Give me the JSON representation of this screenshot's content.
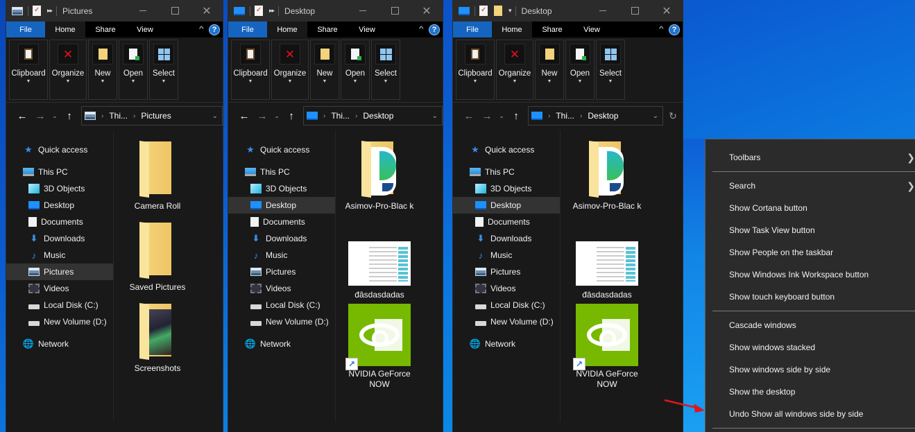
{
  "windows": [
    {
      "title": "Pictures",
      "location_icon": "pictures-icon",
      "ribbon_tabs": [
        "File",
        "Home",
        "Share",
        "View"
      ],
      "ribbon_groups": [
        "Clipboard",
        "Organize",
        "New",
        "Open",
        "Select"
      ],
      "breadcrumb": [
        "Thi...",
        "Pictures"
      ],
      "nav": [
        {
          "label": "Quick access",
          "icon": "quick-access-star-icon",
          "level": 0
        },
        {
          "label": "This PC",
          "icon": "this-pc-icon",
          "level": 0
        },
        {
          "label": "3D Objects",
          "icon": "3d-objects-icon",
          "level": 1
        },
        {
          "label": "Desktop",
          "icon": "desktop-icon",
          "level": 1
        },
        {
          "label": "Documents",
          "icon": "documents-icon",
          "level": 1
        },
        {
          "label": "Downloads",
          "icon": "downloads-icon",
          "level": 1
        },
        {
          "label": "Music",
          "icon": "music-icon",
          "level": 1
        },
        {
          "label": "Pictures",
          "icon": "pictures-icon",
          "level": 1,
          "selected": true
        },
        {
          "label": "Videos",
          "icon": "videos-icon",
          "level": 1
        },
        {
          "label": "Local Disk (C:)",
          "icon": "local-disk-icon",
          "level": 1
        },
        {
          "label": "New Volume (D:)",
          "icon": "drive-icon",
          "level": 1
        },
        {
          "label": "Network",
          "icon": "network-icon",
          "level": 0
        }
      ],
      "items": [
        {
          "name": "Camera Roll",
          "type": "folder"
        },
        {
          "name": "Saved Pictures",
          "type": "folder"
        },
        {
          "name": "Screenshots",
          "type": "folder-screenshots"
        }
      ]
    },
    {
      "title": "Desktop",
      "location_icon": "desktop-icon",
      "ribbon_tabs": [
        "File",
        "Home",
        "Share",
        "View"
      ],
      "ribbon_groups": [
        "Clipboard",
        "Organize",
        "New",
        "Open",
        "Select"
      ],
      "breadcrumb": [
        "Thi...",
        "Desktop"
      ],
      "nav": [
        {
          "label": "Quick access",
          "level": 0
        },
        {
          "label": "This PC",
          "level": 0
        },
        {
          "label": "3D Objects",
          "level": 1
        },
        {
          "label": "Desktop",
          "level": 1,
          "selected": true
        },
        {
          "label": "Documents",
          "level": 1
        },
        {
          "label": "Downloads",
          "level": 1
        },
        {
          "label": "Music",
          "level": 1
        },
        {
          "label": "Pictures",
          "level": 1
        },
        {
          "label": "Videos",
          "level": 1
        },
        {
          "label": "Local Disk (C:)",
          "level": 1
        },
        {
          "label": "New Volume (D:)",
          "level": 1
        },
        {
          "label": "Network",
          "level": 0
        }
      ],
      "items": [
        {
          "name": "Asimov-Pro-Blac k",
          "type": "folder-document"
        },
        {
          "name": "đâsdasdadas",
          "type": "image"
        },
        {
          "name": "NVIDIA GeForce NOW",
          "type": "shortcut"
        }
      ]
    },
    {
      "title": "Desktop",
      "location_icon": "desktop-icon",
      "ribbon_tabs": [
        "File",
        "Home",
        "Share",
        "View"
      ],
      "ribbon_groups": [
        "Clipboard",
        "Organize",
        "New",
        "Open",
        "Select"
      ],
      "breadcrumb": [
        "Thi...",
        "Desktop"
      ],
      "nav": [
        {
          "label": "Quick access",
          "level": 0
        },
        {
          "label": "This PC",
          "level": 0
        },
        {
          "label": "3D Objects",
          "level": 1
        },
        {
          "label": "Desktop",
          "level": 1,
          "selected": true
        },
        {
          "label": "Documents",
          "level": 1
        },
        {
          "label": "Downloads",
          "level": 1
        },
        {
          "label": "Music",
          "level": 1
        },
        {
          "label": "Pictures",
          "level": 1
        },
        {
          "label": "Videos",
          "level": 1
        },
        {
          "label": "Local Disk (C:)",
          "level": 1
        },
        {
          "label": "New Volume (D:)",
          "level": 1
        },
        {
          "label": "Network",
          "level": 0
        }
      ],
      "items": [
        {
          "name": "Asimov-Pro-Blac k",
          "type": "folder-document"
        },
        {
          "name": "đâsdasdadas",
          "type": "image"
        },
        {
          "name": "NVIDIA GeForce NOW",
          "type": "shortcut"
        }
      ]
    }
  ],
  "context_menu": {
    "items": [
      {
        "label": "Toolbars",
        "submenu": true
      },
      {
        "separator": true
      },
      {
        "label": "Search",
        "submenu": true
      },
      {
        "label": "Show Cortana button"
      },
      {
        "label": "Show Task View button"
      },
      {
        "label": "Show People on the taskbar"
      },
      {
        "label": "Show Windows Ink Workspace button"
      },
      {
        "label": "Show touch keyboard button"
      },
      {
        "separator": true
      },
      {
        "label": "Cascade windows"
      },
      {
        "label": "Show windows stacked"
      },
      {
        "label": "Show windows side by side"
      },
      {
        "label": "Show the desktop"
      },
      {
        "label": "Undo Show all windows side by side",
        "highlighted_by_arrow": true
      },
      {
        "separator": true
      }
    ]
  },
  "annotation": {
    "arrow_color": "#e0161c"
  },
  "colors": {
    "accent": "#1565c0",
    "window_bg": "#191919",
    "titlebar_bg": "#2b2b2b",
    "menu_bg": "#2b2b2b"
  }
}
